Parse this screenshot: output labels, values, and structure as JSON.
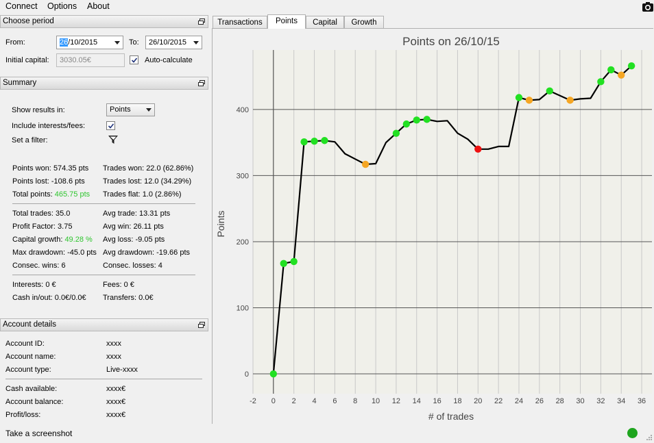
{
  "menubar": {
    "items": [
      "Connect",
      "Options",
      "About"
    ]
  },
  "period": {
    "title": "Choose period",
    "from_label": "From:",
    "from_day_selected": "26",
    "from_rest": "/10/2015",
    "to_label": "To:",
    "to_value": "26/10/2015",
    "initial_capital_label": "Initial capital:",
    "initial_capital_value": "3030.05€",
    "auto_calculate_label": "Auto-calculate",
    "auto_calculate_checked": true
  },
  "summary": {
    "title": "Summary",
    "show_results_label": "Show results in:",
    "show_results_value": "Points",
    "include_interests_label": "Include interests/fees:",
    "include_interests_checked": true,
    "set_filter_label": "Set a filter:",
    "left_col": [
      {
        "label": "Points won:",
        "value": "574.35 pts"
      },
      {
        "label": "Points lost:",
        "value": "-108.6 pts"
      },
      {
        "label": "Total points:",
        "value": "465.75 pts",
        "highlight": true
      },
      {
        "label": "Total trades:",
        "value": "35.0"
      },
      {
        "label": "Profit Factor:",
        "value": "3.75"
      },
      {
        "label": "Capital growth:",
        "value": "49.28 %",
        "highlight": true
      },
      {
        "label": "Max drawdown:",
        "value": "-45.0 pts"
      },
      {
        "label": "Consec. wins:",
        "value": "6"
      },
      {
        "label": "Interests:",
        "value": "0 €"
      },
      {
        "label": "Cash in/out:",
        "value": "0.0€/0.0€"
      }
    ],
    "right_col": [
      {
        "label": "Trades won:",
        "value": "22.0 (62.86%)"
      },
      {
        "label": "Trades lost:",
        "value": "12.0 (34.29%)"
      },
      {
        "label": "Trades flat:",
        "value": "1.0 (2.86%)"
      },
      {
        "label": "Avg trade:",
        "value": "13.31 pts"
      },
      {
        "label": "Avg win:",
        "value": "26.11 pts"
      },
      {
        "label": "Avg loss:",
        "value": "-9.05 pts"
      },
      {
        "label": "Avg drawdown:",
        "value": "-19.66 pts"
      },
      {
        "label": "Consec. losses:",
        "value": "4"
      },
      {
        "label": "Fees:",
        "value": "0 €"
      },
      {
        "label": "Transfers:",
        "value": "0.0€"
      }
    ]
  },
  "account": {
    "title": "Account details",
    "rows": [
      {
        "label": "Account ID:",
        "value": "xxxx"
      },
      {
        "label": "Account name:",
        "value": "xxxx"
      },
      {
        "label": "Account type:",
        "value": "Live-xxxx"
      },
      {
        "label": "Cash available:",
        "value": "xxxx€"
      },
      {
        "label": "Account balance:",
        "value": "xxxx€"
      },
      {
        "label": "Profit/loss:",
        "value": "xxxx€"
      }
    ]
  },
  "tabs": [
    "Transactions",
    "Points",
    "Capital",
    "Growth"
  ],
  "active_tab": "Points",
  "status": {
    "screenshot_label": "Take a screenshot",
    "indicator_color": "#1ea51e"
  },
  "colors": {
    "win": "#22e022",
    "flat": "#f5a623",
    "loss": "#ee1111",
    "highlight": "#2ec52e"
  },
  "chart_data": {
    "type": "line",
    "title": "Points on 26/10/15",
    "xlabel": "# of trades",
    "ylabel": "Points",
    "xlim": [
      -2,
      37
    ],
    "ylim": [
      -30,
      490
    ],
    "xticks": [
      -2,
      0,
      2,
      4,
      6,
      8,
      10,
      12,
      14,
      16,
      18,
      20,
      22,
      24,
      26,
      28,
      30,
      32,
      34,
      36
    ],
    "yticks": [
      0,
      100,
      200,
      300,
      400
    ],
    "grid": true,
    "x": [
      0,
      1,
      2,
      3,
      4,
      5,
      6,
      7,
      8,
      9,
      10,
      11,
      12,
      13,
      14,
      15,
      16,
      17,
      18,
      19,
      20,
      21,
      22,
      23,
      24,
      25,
      26,
      27,
      28,
      29,
      30,
      31,
      32,
      33,
      34,
      35
    ],
    "y": [
      0,
      167,
      170,
      351,
      352,
      353,
      351,
      333,
      325,
      317,
      318,
      350,
      364,
      378,
      384,
      385,
      382,
      383,
      364,
      355,
      340,
      340,
      344,
      344,
      418,
      414,
      415,
      428,
      421,
      414,
      416,
      417,
      442,
      460,
      452,
      466
    ],
    "markers": [
      {
        "x": 0,
        "y": 0,
        "type": "win"
      },
      {
        "x": 1,
        "y": 167,
        "type": "win"
      },
      {
        "x": 2,
        "y": 170,
        "type": "win"
      },
      {
        "x": 3,
        "y": 351,
        "type": "win"
      },
      {
        "x": 4,
        "y": 352,
        "type": "win"
      },
      {
        "x": 5,
        "y": 353,
        "type": "win"
      },
      {
        "x": 9,
        "y": 317,
        "type": "flat"
      },
      {
        "x": 12,
        "y": 364,
        "type": "win"
      },
      {
        "x": 13,
        "y": 378,
        "type": "win"
      },
      {
        "x": 14,
        "y": 384,
        "type": "win"
      },
      {
        "x": 15,
        "y": 385,
        "type": "win"
      },
      {
        "x": 20,
        "y": 340,
        "type": "loss"
      },
      {
        "x": 24,
        "y": 418,
        "type": "win"
      },
      {
        "x": 25,
        "y": 414,
        "type": "flat"
      },
      {
        "x": 27,
        "y": 428,
        "type": "win"
      },
      {
        "x": 29,
        "y": 414,
        "type": "flat"
      },
      {
        "x": 32,
        "y": 442,
        "type": "win"
      },
      {
        "x": 33,
        "y": 460,
        "type": "win"
      },
      {
        "x": 34,
        "y": 452,
        "type": "flat"
      },
      {
        "x": 35,
        "y": 466,
        "type": "win"
      }
    ]
  }
}
